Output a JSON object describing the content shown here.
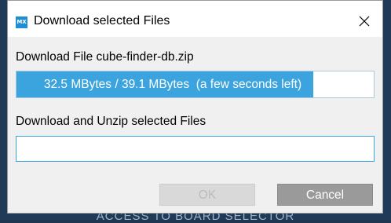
{
  "window": {
    "app_logo_text": "MX",
    "title": "Download selected Files"
  },
  "download": {
    "label": "Download File cube-finder-db.zip",
    "progress_text": "32.5 MBytes / 39.1 MBytes  (a few seconds left)",
    "progress_fraction": 0.83
  },
  "unzip": {
    "label": "Download and Unzip selected Files",
    "progress_fraction": 0
  },
  "buttons": {
    "ok_label": "OK",
    "ok_enabled": false,
    "cancel_label": "Cancel"
  },
  "background": {
    "partial_text": "ACCESS TO BOARD SELECTOR"
  },
  "colors": {
    "accent": "#3ba3dd",
    "logo": "#1e8fd6",
    "dialog_bg": "#f0f0f0"
  }
}
